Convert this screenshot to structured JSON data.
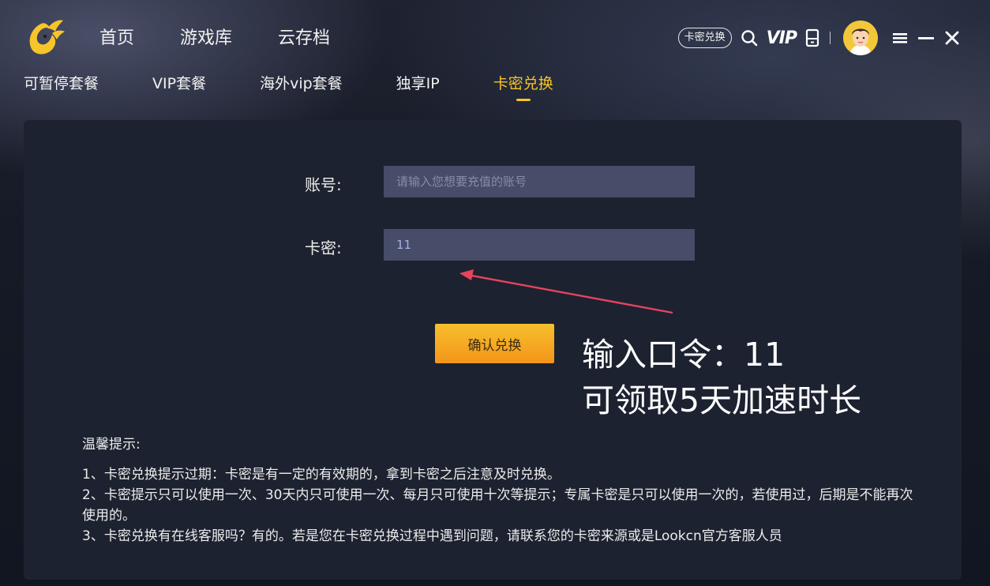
{
  "nav": {
    "items": [
      "首页",
      "游戏库",
      "云存档"
    ]
  },
  "toolbar": {
    "redeem_badge": "卡密兑换",
    "vip_label": "VIP"
  },
  "subtabs": [
    {
      "label": "可暂停套餐",
      "active": false
    },
    {
      "label": "VIP套餐",
      "active": false
    },
    {
      "label": "海外vip套餐",
      "active": false
    },
    {
      "label": "独享IP",
      "active": false
    },
    {
      "label": "卡密兑换",
      "active": true
    }
  ],
  "form": {
    "account_label": "账号:",
    "account_placeholder": "请输入您想要充值的账号",
    "account_value": "",
    "card_label": "卡密:",
    "card_value": "11",
    "confirm_label": "确认兑换"
  },
  "annotation": {
    "line1": "输入口令：11",
    "line2": "可领取5天加速时长"
  },
  "tips": {
    "title": "温馨提示:",
    "items": [
      "1、卡密兑换提示过期：卡密是有一定的有效期的，拿到卡密之后注意及时兑换。",
      "2、卡密提示只可以使用一次、30天内只可使用一次、每月只可使用十次等提示；专属卡密是只可以使用一次的，若使用过，后期是不能再次使用的。",
      "3、卡密兑换有在线客服吗？有的。若是您在卡密兑换过程中遇到问题，请联系您的卡密来源或是Lookcn官方客服人员"
    ]
  },
  "colors": {
    "accent": "#f6c52a",
    "panel": "#1d2230",
    "input": "#474c69",
    "arrow": "#e8445d"
  },
  "icons": {
    "logo": "bird-logo-icon",
    "search": "search-icon",
    "phone": "phone-icon",
    "menu": "menu-icon",
    "minimize": "minimize-icon",
    "close": "close-icon"
  }
}
